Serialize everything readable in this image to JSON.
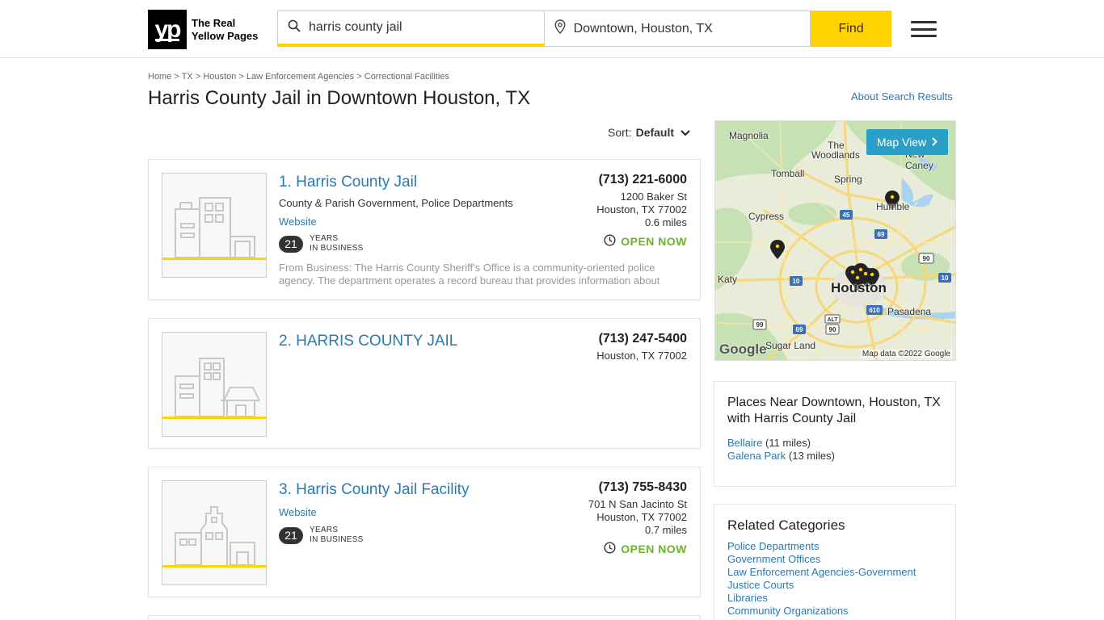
{
  "header": {
    "logo_mark": "yp",
    "logo_line1": "The Real",
    "logo_line2": "Yellow Pages",
    "search_value": "harris county jail",
    "location_value": "Downtown, Houston, TX",
    "find_label": "Find"
  },
  "breadcrumb": [
    "Home",
    "TX",
    "Houston",
    "Law Enforcement Agencies",
    "Correctional Facilities"
  ],
  "breadcrumb_sep": ">",
  "page_title": "Harris County Jail in Downtown Houston, TX",
  "about_link": "About Search Results",
  "sort": {
    "label": "Sort:",
    "value": "Default"
  },
  "results": [
    {
      "name": "1. Harris County Jail",
      "categories": "County & Parish Government, Police Departments",
      "website": "Website",
      "years": "21",
      "years_line1": "YEARS",
      "years_line2": "IN BUSINESS",
      "snippet": "From Business: The Harris County Sheriff's Office is a community-oriented police agency. The department operates a record bureau that provides information about",
      "phone": "(713) 221-6000",
      "street": "1200 Baker St",
      "city": "Houston, TX 77002",
      "distance": "0.6 miles",
      "open": "OPEN NOW"
    },
    {
      "name": "2. HARRIS COUNTY JAIL",
      "phone": "(713) 247-5400",
      "city": "Houston, TX 77002"
    },
    {
      "name": "3. Harris County Jail Facility",
      "website": "Website",
      "years": "21",
      "years_line1": "YEARS",
      "years_line2": "IN BUSINESS",
      "phone": "(713) 755-8430",
      "street": "701 N San Jacinto St",
      "city": "Houston, TX 77002",
      "distance": "0.7 miles",
      "open": "OPEN NOW"
    }
  ],
  "map": {
    "button": "Map View",
    "labels": {
      "magnolia": "Magnolia",
      "woodlands_1": "The",
      "woodlands_2": "Woodlands",
      "new_caney": "New Caney",
      "tomball": "Tomball",
      "spring": "Spring",
      "humble": "Humble",
      "cypress": "Cypress",
      "katy": "Katy",
      "houston": "Houston",
      "pasadena": "Pasadena",
      "sugar_land": "Sugar Land"
    },
    "highways": [
      "45",
      "69",
      "90",
      "10",
      "10",
      "610",
      "99",
      "69",
      "ALT",
      "90"
    ],
    "google": "Google",
    "credit": "Map data ©2022 Google"
  },
  "places_near": {
    "title": "Places Near Downtown, Houston, TX with Harris County Jail",
    "items": [
      {
        "name": "Bellaire",
        "dist": "(11 miles)"
      },
      {
        "name": "Galena Park",
        "dist": "(13 miles)"
      }
    ]
  },
  "related": {
    "title": "Related Categories",
    "items": [
      "Police Departments",
      "Government Offices",
      "Law Enforcement Agencies-Government",
      "Justice Courts",
      "Libraries",
      "Community Organizations"
    ]
  },
  "colors": {
    "accent": "#ffd200",
    "link": "#2a7ab0",
    "open": "#6cb42c",
    "map_button": "#2aa0c9"
  }
}
